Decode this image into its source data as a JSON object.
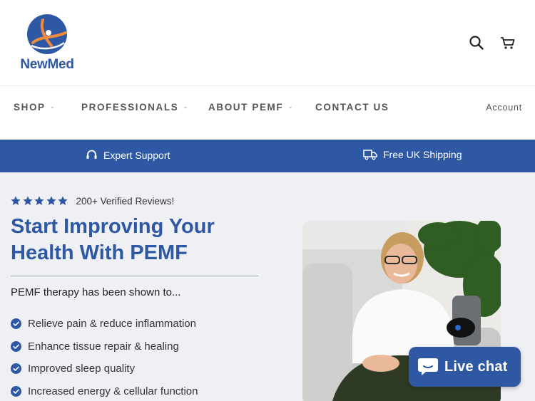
{
  "brand": {
    "name": "NewMed",
    "primary_color": "#2f58a4"
  },
  "header": {
    "search_icon": "search-icon",
    "cart_icon": "cart-icon"
  },
  "nav": {
    "items": [
      {
        "label": "SHOP",
        "has_dropdown": true
      },
      {
        "label": "PROFESSIONALS",
        "has_dropdown": true
      },
      {
        "label": "ABOUT PEMF",
        "has_dropdown": true
      },
      {
        "label": "CONTACT US",
        "has_dropdown": false
      }
    ],
    "account": "Account"
  },
  "banner": {
    "support": "Expert Support",
    "shipping": "Free UK Shipping"
  },
  "hero": {
    "rating_stars": 5,
    "reviews": "200+ Verified Reviews!",
    "headline": "Start Improving Your Health With PEMF",
    "intro": "PEMF therapy has been shown to...",
    "benefits": [
      "Relieve pain & reduce inflammation",
      "Enhance tissue repair & healing",
      "Improved sleep quality",
      "Increased energy & cellular function"
    ]
  },
  "chat": {
    "label": "Live chat"
  }
}
